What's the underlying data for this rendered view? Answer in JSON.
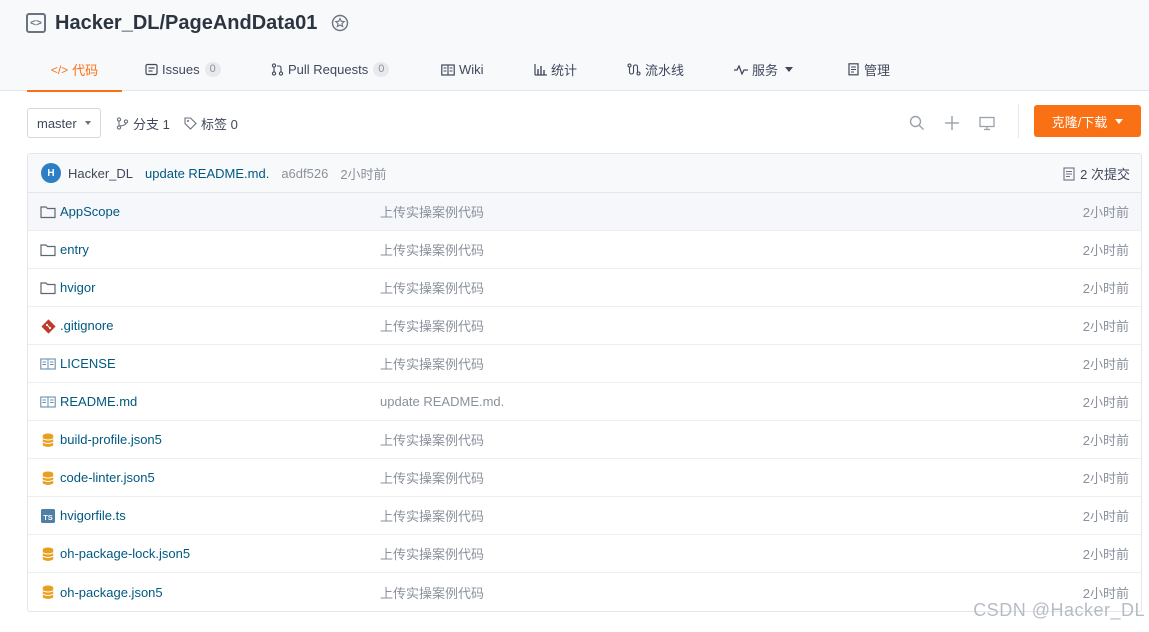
{
  "repo": {
    "name": "Hacker_DL/PageAndData01",
    "icon": "repo-code-icon",
    "badge_icon": "award-icon"
  },
  "tabs": [
    {
      "label": "代码",
      "icon": "code-icon",
      "active": true
    },
    {
      "label": "Issues",
      "icon": "issues-icon",
      "count": "0"
    },
    {
      "label": "Pull Requests",
      "icon": "pull-request-icon",
      "count": "0"
    },
    {
      "label": "Wiki",
      "icon": "wiki-icon"
    },
    {
      "label": "统计",
      "icon": "stats-icon"
    },
    {
      "label": "流水线",
      "icon": "pipeline-icon"
    },
    {
      "label": "服务",
      "icon": "service-icon"
    },
    {
      "label": "管理",
      "icon": "manage-icon"
    }
  ],
  "toolbar": {
    "branch": "master",
    "branches_label": "分支 1",
    "tags_label": "标签 0",
    "clone_label": "克隆/下载"
  },
  "commit": {
    "avatar": "H",
    "user": "Hacker_DL",
    "message": "update README.md.",
    "sha": "a6df526",
    "time": "2小时前",
    "count_label": "2 次提交"
  },
  "files": [
    {
      "name": "AppScope",
      "icon": "folder-icon",
      "message": "上传实操案例代码",
      "time": "2小时前"
    },
    {
      "name": "entry",
      "icon": "folder-icon",
      "message": "上传实操案例代码",
      "time": "2小时前"
    },
    {
      "name": "hvigor",
      "icon": "folder-icon",
      "message": "上传实操案例代码",
      "time": "2小时前"
    },
    {
      "name": ".gitignore",
      "icon": "git-icon",
      "message": "上传实操案例代码",
      "time": "2小时前"
    },
    {
      "name": "LICENSE",
      "icon": "book-icon",
      "message": "上传实操案例代码",
      "time": "2小时前"
    },
    {
      "name": "README.md",
      "icon": "book-icon",
      "message": "update README.md.",
      "time": "2小时前"
    },
    {
      "name": "build-profile.json5",
      "icon": "database-icon",
      "message": "上传实操案例代码",
      "time": "2小时前"
    },
    {
      "name": "code-linter.json5",
      "icon": "database-icon",
      "message": "上传实操案例代码",
      "time": "2小时前"
    },
    {
      "name": "hvigorfile.ts",
      "icon": "typescript-icon",
      "message": "上传实操案例代码",
      "time": "2小时前"
    },
    {
      "name": "oh-package-lock.json5",
      "icon": "database-icon",
      "message": "上传实操案例代码",
      "time": "2小时前"
    },
    {
      "name": "oh-package.json5",
      "icon": "database-icon",
      "message": "上传实操案例代码",
      "time": "2小时前"
    }
  ],
  "watermark": "CSDN @Hacker_DL",
  "colors": {
    "accent": "#fa7014",
    "link": "#005980",
    "muted": "#8a919c"
  }
}
